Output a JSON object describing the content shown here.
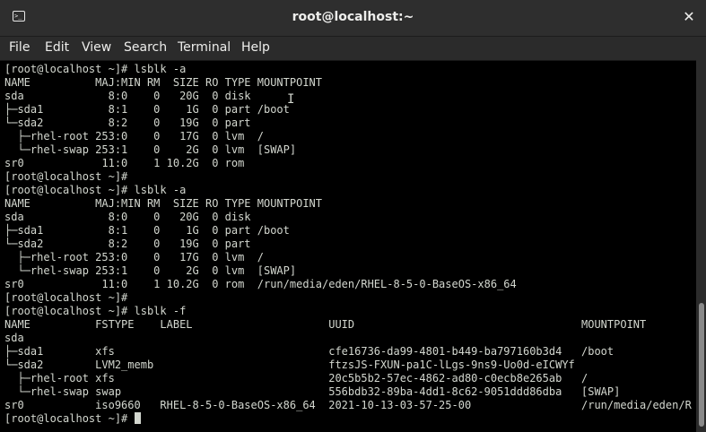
{
  "window": {
    "title": "root@localhost:~",
    "close_glyph": "✕",
    "icon": "terminal-icon",
    "icon_glyph": ">_"
  },
  "menu": {
    "items": [
      {
        "label": "File"
      },
      {
        "label": "Edit"
      },
      {
        "label": "View"
      },
      {
        "label": "Search"
      },
      {
        "label": "Terminal"
      },
      {
        "label": "Help"
      }
    ]
  },
  "terminal": {
    "lines": [
      "[root@localhost ~]# lsblk -a",
      "NAME          MAJ:MIN RM  SIZE RO TYPE MOUNTPOINT",
      "sda             8:0    0   20G  0 disk",
      "├─sda1          8:1    0    1G  0 part /boot",
      "└─sda2          8:2    0   19G  0 part",
      "  ├─rhel-root 253:0    0   17G  0 lvm  /",
      "  └─rhel-swap 253:1    0    2G  0 lvm  [SWAP]",
      "sr0            11:0    1 10.2G  0 rom",
      "[root@localhost ~]#",
      "[root@localhost ~]# lsblk -a",
      "NAME          MAJ:MIN RM  SIZE RO TYPE MOUNTPOINT",
      "sda             8:0    0   20G  0 disk",
      "├─sda1          8:1    0    1G  0 part /boot",
      "└─sda2          8:2    0   19G  0 part",
      "  ├─rhel-root 253:0    0   17G  0 lvm  /",
      "  └─rhel-swap 253:1    0    2G  0 lvm  [SWAP]",
      "sr0            11:0    1 10.2G  0 rom  /run/media/eden/RHEL-8-5-0-BaseOS-x86_64",
      "[root@localhost ~]#",
      "[root@localhost ~]# lsblk -f",
      "NAME          FSTYPE    LABEL                     UUID                                   MOUNTPOINT",
      "sda",
      "├─sda1        xfs                                 cfe16736-da99-4801-b449-ba797160b3d4   /boot",
      "└─sda2        LVM2_memb                           ftzsJS-FXUN-pa1C-lLgs-9ns9-Uo0d-eICWYf",
      "  ├─rhel-root xfs                                 20c5b5b2-57ec-4862-ad80-c0ecb8e265ab   /",
      "  └─rhel-swap swap                                556bdb32-89ba-4dd1-8c62-9051ddd86dba   [SWAP]",
      "sr0           iso9660   RHEL-8-5-0-BaseOS-x86_64  2021-10-13-03-57-25-00                 /run/media/eden/R"
    ],
    "prompt": "[root@localhost ~]# "
  },
  "colors": {
    "background": "#000000",
    "foreground": "#d3d7cf",
    "chrome": "#2b2b2b"
  }
}
